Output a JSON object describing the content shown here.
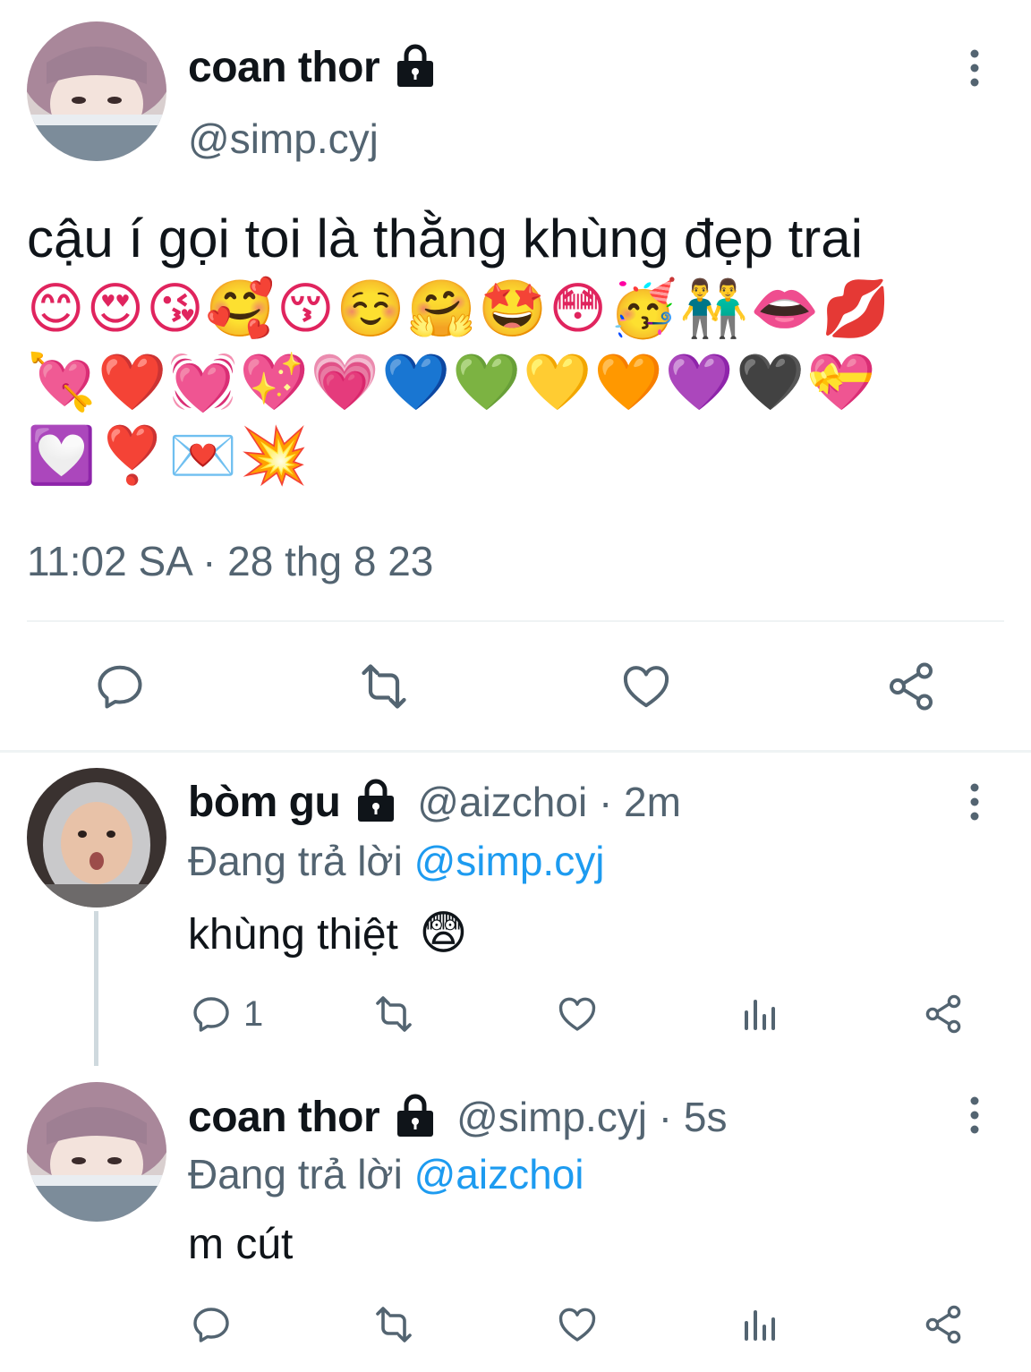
{
  "main_tweet": {
    "author_name": "coan thor",
    "author_handle": "@simp.cyj",
    "text": "cậu í gọi toi là thằng khùng đẹp trai",
    "emoji_rows": [
      "😊😍😘🥰😚☺️🤗🤩😳🥳👬👄💋",
      "💘❤️💓💖💗💙💚💛🧡💜🖤💝",
      "💟❣️💌💥"
    ],
    "timestamp": "11:02 SA · 28 thg 8 23",
    "icons": {
      "lock": "lock-icon",
      "more": "more-vertical-icon",
      "reply": "reply-bubble-icon",
      "retweet": "retweet-icon",
      "like": "heart-icon",
      "share": "share-icon"
    }
  },
  "replies": [
    {
      "author_name": "bòm gu",
      "handle_time": "@aizchoi · 2m",
      "replying_prefix": "Đang trả lời",
      "replying_to": "@simp.cyj",
      "text": "khùng thiệt",
      "emoji": "😨",
      "reply_count": "1"
    },
    {
      "author_name": "coan thor",
      "handle_time": "@simp.cyj · 5s",
      "replying_prefix": "Đang trả lời",
      "replying_to": "@aizchoi",
      "text": "m cút",
      "emoji": "",
      "reply_count": ""
    }
  ],
  "colors": {
    "text_primary": "#0f1419",
    "text_secondary": "#536471",
    "mention": "#1d9bf0",
    "divider": "#eff3f4",
    "thread_line": "#cfd9de"
  }
}
